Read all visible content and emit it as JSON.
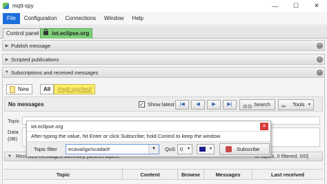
{
  "window": {
    "title": "mqtt-spy",
    "minimize": "—",
    "maximize": "☐",
    "close": "✕"
  },
  "menu": [
    "File",
    "Configuration",
    "Connections",
    "Window",
    "Help"
  ],
  "connection_tabs": {
    "control_panel": "Control panel",
    "connection": "iot.eclipse.org"
  },
  "panels": {
    "publish": "Publish message",
    "scripted": "Scripted publications",
    "subscriptions": "Subscriptions and received messages"
  },
  "subscription_tabs": {
    "new": "New",
    "all": "All",
    "topic": "/mqtt-spy/test/"
  },
  "toolbar": {
    "no_messages": "No messages",
    "show_latest": "Show latest",
    "checked": "✓",
    "search": "Search",
    "tools": "Tools"
  },
  "left_labels": {
    "topic": "Topic",
    "data": "Data",
    "data_count": "(0B)"
  },
  "popup": {
    "title": "iot.eclipse.org",
    "hint": "After typing the value, hit Enter or click Subscribe; hold Control to keep the window",
    "topic_filter_label": "Topic filter",
    "topic_filter_value": "ecava/igx/scada/#",
    "qos_label": "QoS",
    "qos_value": "0",
    "subscribe": "Subscribe",
    "color": "#1e1e8c"
  },
  "summary": {
    "left": "Received messages summary [search topics:",
    "right": "to topics, 0 filtered, 0/0]"
  },
  "table_headers": [
    "Topic",
    "Content",
    "Browse",
    "Messages",
    "Last received"
  ],
  "colors": {
    "accent": "#1e6fd9",
    "connection_tab": "#7fd07a",
    "topic_tab": "#fff06b"
  }
}
